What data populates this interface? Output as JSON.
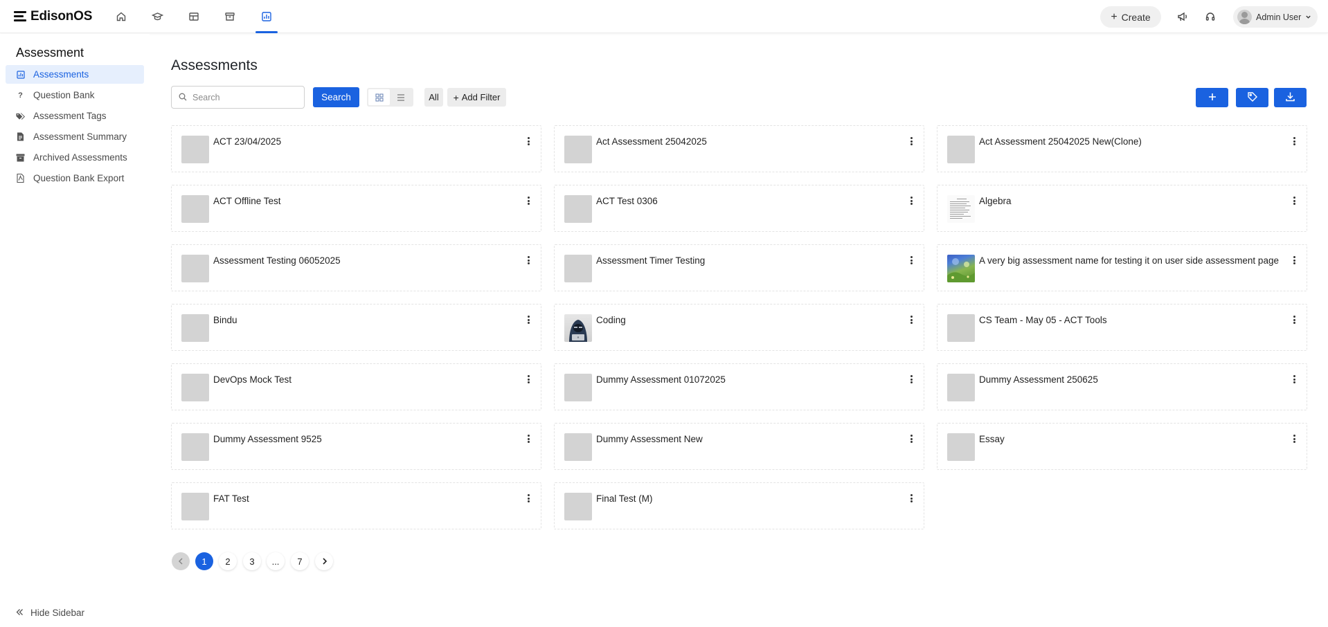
{
  "brand": {
    "name": "EdisonOS"
  },
  "topnav": {
    "icons": [
      "home-icon",
      "graduation-cap-icon",
      "table-icon",
      "archive-box-icon",
      "assessment-chart-icon"
    ],
    "active_index": 4,
    "create_label": "Create",
    "user_name": "Admin User"
  },
  "sidebar": {
    "title": "Assessment",
    "items": [
      {
        "label": "Assessments",
        "icon": "chart-icon",
        "active": true
      },
      {
        "label": "Question Bank",
        "icon": "question-icon",
        "active": false
      },
      {
        "label": "Assessment Tags",
        "icon": "tags-icon",
        "active": false
      },
      {
        "label": "Assessment Summary",
        "icon": "document-icon",
        "active": false
      },
      {
        "label": "Archived Assessments",
        "icon": "archive-icon",
        "active": false
      },
      {
        "label": "Question Bank Export",
        "icon": "pdf-file-icon",
        "active": false
      }
    ],
    "hide_label": "Hide Sidebar"
  },
  "main": {
    "title": "Assessments",
    "search_placeholder": "Search",
    "search_button": "Search",
    "all_label": "All",
    "add_filter_label": "Add Filter",
    "cards": [
      {
        "title": "ACT 23/04/2025",
        "thumb": "placeholder"
      },
      {
        "title": "Act Assessment 25042025",
        "thumb": "placeholder"
      },
      {
        "title": "Act Assessment 25042025 New(Clone)",
        "thumb": "placeholder"
      },
      {
        "title": "ACT Offline Test",
        "thumb": "placeholder"
      },
      {
        "title": "ACT Test 0306",
        "thumb": "placeholder"
      },
      {
        "title": "Algebra",
        "thumb": "document"
      },
      {
        "title": "Assessment Testing 06052025",
        "thumb": "placeholder"
      },
      {
        "title": "Assessment Timer Testing",
        "thumb": "placeholder"
      },
      {
        "title": "A very big assessment name for testing it on user side assessment page",
        "thumb": "landscape"
      },
      {
        "title": "Bindu",
        "thumb": "placeholder"
      },
      {
        "title": "Coding",
        "thumb": "coder"
      },
      {
        "title": "CS Team - May 05 - ACT Tools",
        "thumb": "placeholder"
      },
      {
        "title": "DevOps Mock Test",
        "thumb": "placeholder"
      },
      {
        "title": "Dummy Assessment 01072025",
        "thumb": "placeholder"
      },
      {
        "title": "Dummy Assessment 250625",
        "thumb": "placeholder"
      },
      {
        "title": "Dummy Assessment 9525",
        "thumb": "placeholder"
      },
      {
        "title": "Dummy Assessment New",
        "thumb": "placeholder"
      },
      {
        "title": "Essay",
        "thumb": "placeholder"
      },
      {
        "title": "FAT Test",
        "thumb": "placeholder"
      },
      {
        "title": "Final Test (M)",
        "thumb": "placeholder"
      }
    ]
  },
  "pagination": {
    "pages": [
      "1",
      "2",
      "3",
      "...",
      "7"
    ],
    "current": "1"
  },
  "colors": {
    "accent": "#1a62e0",
    "active_bg": "#e6effd",
    "thumb_placeholder": "#d3d3d3"
  }
}
